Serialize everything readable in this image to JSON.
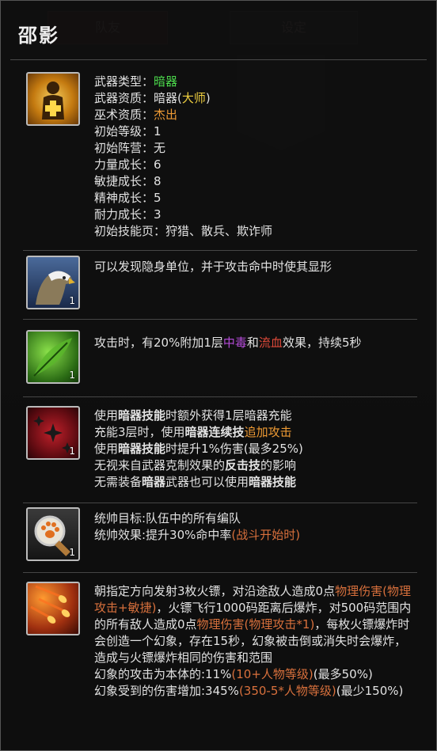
{
  "header": {
    "title": "邵影"
  },
  "background": {
    "tab_left": "队友",
    "tab_right": "设定",
    "badge_value": "0"
  },
  "sections": [
    {
      "icon": "sun-figure-icon",
      "icon_num": "",
      "lines": {
        "l1_label": "武器类型：",
        "l1_value": "暗器",
        "l2_label": "武器资质：",
        "l2_value": "暗器(",
        "l2_hl": "大师",
        "l2_end": ")",
        "l3_label": "巫术资质：",
        "l3_value": "杰出",
        "l4": "初始等级：1",
        "l5": "初始阵营：无",
        "l6": "力量成长：6",
        "l7": "敏捷成长：8",
        "l8": "精神成长：5",
        "l9": "耐力成长：3",
        "l10": "初始技能页：狩猎、散兵、欺诈师"
      }
    },
    {
      "icon": "eagle-icon",
      "icon_num": "1",
      "t1": "可以发现隐身单位，并于攻击命中时使其显形"
    },
    {
      "icon": "leaf-icon",
      "icon_num": "1",
      "t1": "攻击时，有20%附加1层",
      "hl1": "中毒",
      "t2": "和",
      "hl2": "流血",
      "t3": "效果，持续5秒"
    },
    {
      "icon": "shuriken-icon",
      "icon_num": "1",
      "a1": "使用",
      "a1b": "暗器技能",
      "a1c": "时额外获得1层暗器充能",
      "b1": "充能3层时，使用",
      "b1b": "暗器连续技",
      "b1c": "追加攻击",
      "c1": "使用",
      "c1b": "暗器技能",
      "c1c": "时提升1%伤害(最多25%)",
      "d1": "无视来自武器克制效果的",
      "d1b": "反击技",
      "d1c": "的影响",
      "e1": "无需装备",
      "e1b": "暗器",
      "e1c": "武器也可以使用",
      "e1d": "暗器技能"
    },
    {
      "icon": "paw-magnifier-icon",
      "icon_num": "1",
      "l1": "统帅目标:队伍中的所有编队",
      "l2": "统帅效果:提升30%命中率",
      "l2hl": "(战斗开始时)"
    },
    {
      "icon": "fire-darts-icon",
      "icon_num": "",
      "p1": "朝指定方向发射3枚火镖，对沿途敌人造成0点",
      "p1hl": "物理伤害(物理攻击+敏捷)",
      "p2": "，火镖飞行1000码距离后爆炸，对500码范围内的所有敌人造成0点",
      "p2hl": "物理伤害(物理攻击*1)",
      "p3": "，每枚火镖爆炸时会创造一个幻象，存在15秒，幻象被击倒或消失时会爆炸，造成与火镖爆炸相同的伤害和范围",
      "q1": "幻象的攻击为本体的:11%",
      "q1hl": "(10+人物等级)",
      "q1end": "(最多50%)",
      "r1": "幻象受到的伤害增加:345%",
      "r1hl": "(350-5*人物等级)",
      "r1end": "(最少150%)"
    }
  ]
}
